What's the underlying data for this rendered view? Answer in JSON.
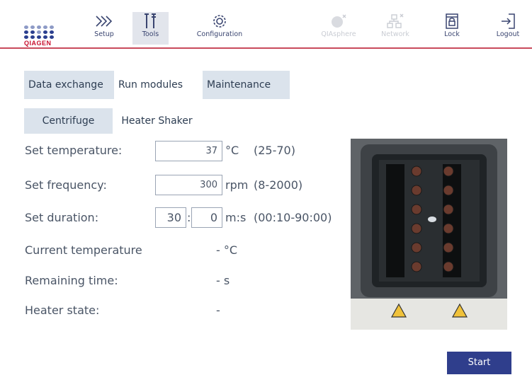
{
  "brand": {
    "logo_text": "QIAGEN"
  },
  "toolbar": {
    "setup": "Setup",
    "tools": "Tools",
    "configuration": "Configuration",
    "qiasphere": "QIAsphere",
    "network": "Network",
    "lock": "Lock",
    "logout": "Logout"
  },
  "tabs": [
    "Data exchange",
    "Run modules",
    "Maintenance"
  ],
  "subtabs": [
    "Centrifuge",
    "Heater Shaker"
  ],
  "settings": {
    "temperature": {
      "label": "Set temperature:",
      "value": "37",
      "unit": "°C",
      "range": "(25-70)"
    },
    "frequency": {
      "label": "Set frequency:",
      "value": "300",
      "unit": "rpm",
      "range": "(8-2000)"
    },
    "duration": {
      "label": "Set duration:",
      "minutes": "30",
      "separator": ":",
      "seconds": "0",
      "unit": "m:s",
      "range": "(00:10-90:00)"
    }
  },
  "status": {
    "current_temperature": {
      "label": "Current temperature",
      "value": "- °C"
    },
    "remaining_time": {
      "label": "Remaining time:",
      "value": "- s"
    },
    "heater_state": {
      "label": "Heater state:",
      "value": "-"
    }
  },
  "actions": {
    "start": "Start"
  },
  "colors": {
    "accent_line": "#c94a5c",
    "primary_button": "#2f3e8c",
    "tab_background": "#dbe3ec",
    "brand_red": "#c8102e",
    "brand_blue": "#2b3f8f"
  },
  "icons": [
    "setup-icon",
    "tools-icon",
    "configuration-icon",
    "qiasphere-icon",
    "network-icon",
    "lock-icon",
    "logout-icon",
    "warning-icon"
  ]
}
